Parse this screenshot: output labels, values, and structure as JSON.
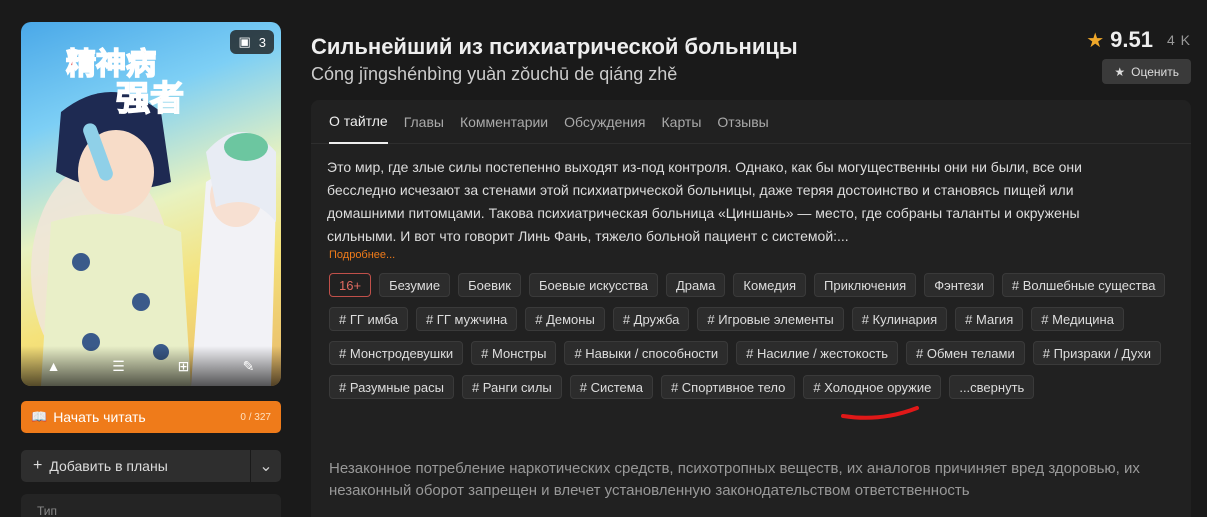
{
  "cover": {
    "gallery_count": "3",
    "gallery_icon": "image-icon",
    "actions": [
      "warning-icon",
      "list-icon",
      "plus-square-icon",
      "edit-icon"
    ]
  },
  "read_button": {
    "label": "Начать читать",
    "progress": "0 / 327",
    "icon": "book-icon"
  },
  "plans_button": {
    "label": "Добавить в планы"
  },
  "info_box": {
    "label": "Тип"
  },
  "title": "Сильнейший из психиатрической больницы",
  "subtitle": "Cóng jīngshénbìng yuàn zǒuchū de qiáng zhě",
  "rating": {
    "score": "9.51",
    "votes": "4 K",
    "rate_label": "Оценить"
  },
  "tabs": [
    {
      "label": "О тайтле",
      "active": true
    },
    {
      "label": "Главы"
    },
    {
      "label": "Комментарии"
    },
    {
      "label": "Обсуждения"
    },
    {
      "label": "Карты"
    },
    {
      "label": "Отзывы"
    }
  ],
  "description": "Это мир, где злые силы постепенно выходят из-под контроля. Однако, как бы могущественны они ни были, все они бесследно исчезают за стенами этой психиатрической больницы, даже теряя достоинство и становясь пищей или домашними питомцами. Такова психиатрическая больница «Циншань» — место, где собраны таланты и окружены сильными. И вот что говорит Линь Фань, тяжело больной пациент с системой:...",
  "more_label": "Подробнее...",
  "age_rating": "16+",
  "genres": [
    "Безумие",
    "Боевик",
    "Боевые искусства",
    "Драма",
    "Комедия",
    "Приключения",
    "Фэнтези"
  ],
  "tags": [
    "# Волшебные существа",
    "# ГГ имба",
    "# ГГ мужчина",
    "# Демоны",
    "# Дружба",
    "# Игровые элементы",
    "# Кулинария",
    "# Магия",
    "# Медицина",
    "# Монстродевушки",
    "# Монстры",
    "# Навыки / способности",
    "# Насилие / жестокость",
    "# Обмен телами",
    "# Призраки / Духи",
    "# Разумные расы",
    "# Ранги силы",
    "# Система",
    "# Спортивное тело",
    "# Холодное оружие"
  ],
  "collapse_label": "...свернуть",
  "disclaimer": "Незаконное потребление наркотических средств, психотропных веществ, их аналогов причиняет вред здоровью, их незаконный оборот запрещен и влечет установленную законодательством ответственность",
  "accent_color": "#ef7b1a"
}
